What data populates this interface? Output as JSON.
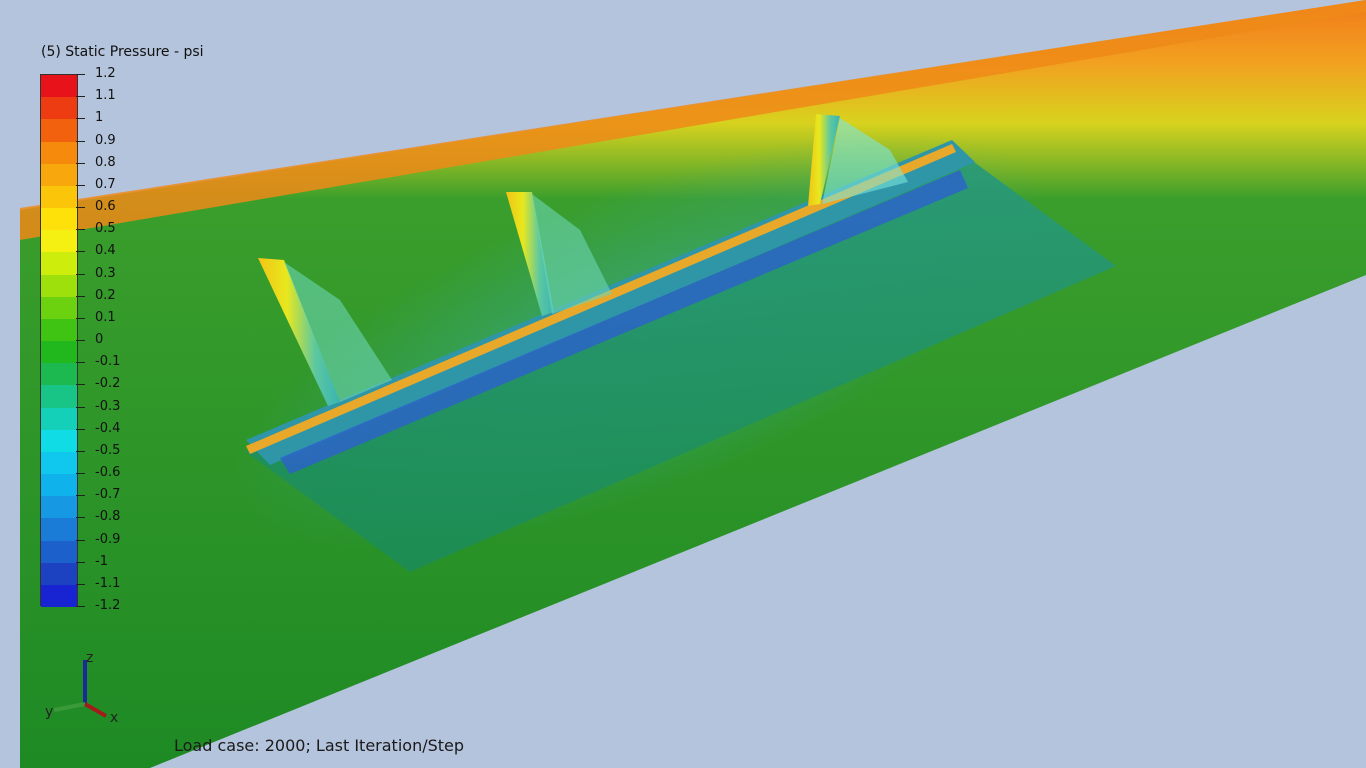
{
  "legend": {
    "title": "(5) Static Pressure - psi",
    "ticks": [
      "1.2",
      "1.1",
      "1",
      "0.9",
      "0.8",
      "0.7",
      "0.6",
      "0.5",
      "0.4",
      "0.3",
      "0.2",
      "0.1",
      "0",
      "-0.1",
      "-0.2",
      "-0.3",
      "-0.4",
      "-0.5",
      "-0.6",
      "-0.7",
      "-0.8",
      "-0.9",
      "-1",
      "-1.1",
      "-1.2"
    ],
    "colors": [
      "#e8121a",
      "#ee3c12",
      "#f2620e",
      "#f58a0c",
      "#f8a80c",
      "#fbc50a",
      "#fde108",
      "#f6f012",
      "#cdee0c",
      "#9ee00c",
      "#6cd210",
      "#3fc414",
      "#20b81c",
      "#1cb850",
      "#18c486",
      "#14d0b8",
      "#10dce6",
      "#10c8ee",
      "#10b2ec",
      "#1698e2",
      "#1a7cd6",
      "#1c60cc",
      "#1c42c2",
      "#1824d2"
    ]
  },
  "axes_triad": {
    "z": "z",
    "y": "y",
    "x": "x"
  },
  "status": {
    "text": "Load case: 2000; Last Iteration/Step"
  }
}
